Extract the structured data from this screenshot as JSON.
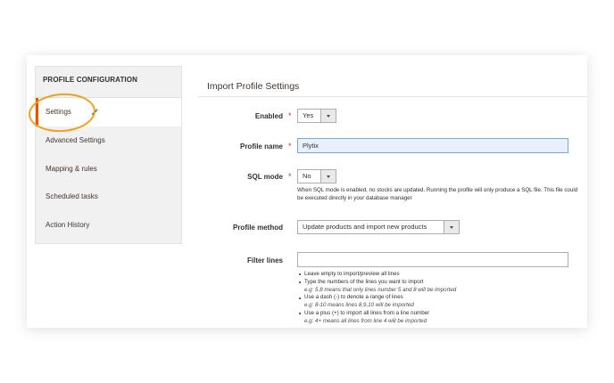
{
  "sidebar": {
    "title": "PROFILE CONFIGURATION",
    "items": [
      {
        "label": "Settings",
        "active": true
      },
      {
        "label": "Advanced Settings"
      },
      {
        "label": "Mapping & rules"
      },
      {
        "label": "Scheduled tasks"
      },
      {
        "label": "Action History"
      }
    ]
  },
  "main": {
    "title": "Import Profile Settings",
    "enabled": {
      "label": "Enabled",
      "value": "Yes"
    },
    "profile_name": {
      "label": "Profile name",
      "value": "Plytix"
    },
    "sql_mode": {
      "label": "SQL mode",
      "value": "No",
      "note": "When SQL mode is enabled, no stocks are updated. Running the profile will only produce a SQL file. This file could be executed directly in your database manager"
    },
    "profile_method": {
      "label": "Profile method",
      "value": "Update products and import new products"
    },
    "filter_lines": {
      "label": "Filter lines",
      "value": "",
      "help": [
        {
          "text": "Leave empty to import/preview all lines"
        },
        {
          "text": "Type the numbers of the lines you want to import",
          "example": "e.g: 5,8 means that only lines number 5 and 8 will be imported"
        },
        {
          "text": "Use a dash (-) to denote a range of lines",
          "example": "e.g: 8-10 means lines 8,9,10 will be imported"
        },
        {
          "text": "Use a plus (+) to import all lines from a line number",
          "example": "e.g: 4+ means all lines from line 4 will be imported"
        }
      ]
    },
    "required_mark": "*"
  },
  "colors": {
    "accent": "#eb5202",
    "highlight_ring": "#f2a01d",
    "required": "#e22626"
  }
}
